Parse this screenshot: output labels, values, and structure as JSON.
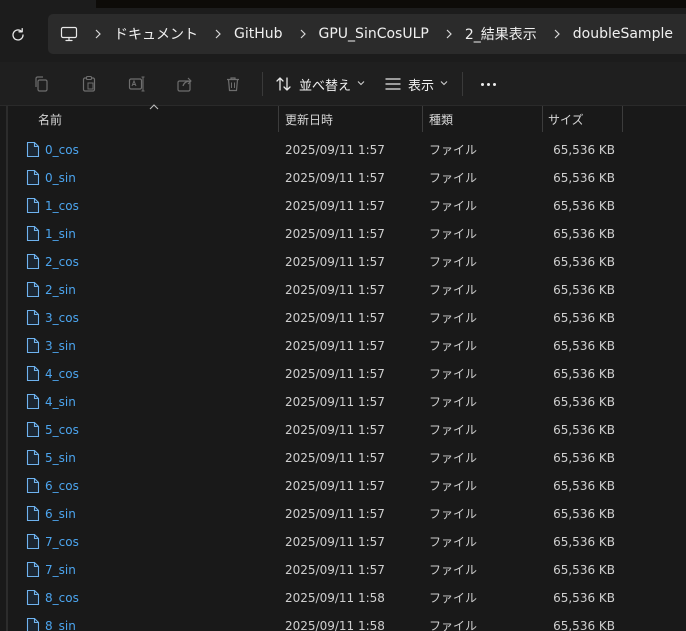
{
  "breadcrumb": {
    "items": [
      "ドキュメント",
      "GitHub",
      "GPU_SinCosULP",
      "2_結果表示",
      "doubleSample"
    ]
  },
  "toolbar": {
    "sort_label": "並べ替え",
    "view_label": "表示"
  },
  "columns": {
    "name": "名前",
    "modified": "更新日時",
    "type": "種類",
    "size": "サイズ"
  },
  "files": [
    {
      "name": "0_cos",
      "modified": "2025/09/11 1:57",
      "type": "ファイル",
      "size": "65,536 KB"
    },
    {
      "name": "0_sin",
      "modified": "2025/09/11 1:57",
      "type": "ファイル",
      "size": "65,536 KB"
    },
    {
      "name": "1_cos",
      "modified": "2025/09/11 1:57",
      "type": "ファイル",
      "size": "65,536 KB"
    },
    {
      "name": "1_sin",
      "modified": "2025/09/11 1:57",
      "type": "ファイル",
      "size": "65,536 KB"
    },
    {
      "name": "2_cos",
      "modified": "2025/09/11 1:57",
      "type": "ファイル",
      "size": "65,536 KB"
    },
    {
      "name": "2_sin",
      "modified": "2025/09/11 1:57",
      "type": "ファイル",
      "size": "65,536 KB"
    },
    {
      "name": "3_cos",
      "modified": "2025/09/11 1:57",
      "type": "ファイル",
      "size": "65,536 KB"
    },
    {
      "name": "3_sin",
      "modified": "2025/09/11 1:57",
      "type": "ファイル",
      "size": "65,536 KB"
    },
    {
      "name": "4_cos",
      "modified": "2025/09/11 1:57",
      "type": "ファイル",
      "size": "65,536 KB"
    },
    {
      "name": "4_sin",
      "modified": "2025/09/11 1:57",
      "type": "ファイル",
      "size": "65,536 KB"
    },
    {
      "name": "5_cos",
      "modified": "2025/09/11 1:57",
      "type": "ファイル",
      "size": "65,536 KB"
    },
    {
      "name": "5_sin",
      "modified": "2025/09/11 1:57",
      "type": "ファイル",
      "size": "65,536 KB"
    },
    {
      "name": "6_cos",
      "modified": "2025/09/11 1:57",
      "type": "ファイル",
      "size": "65,536 KB"
    },
    {
      "name": "6_sin",
      "modified": "2025/09/11 1:57",
      "type": "ファイル",
      "size": "65,536 KB"
    },
    {
      "name": "7_cos",
      "modified": "2025/09/11 1:57",
      "type": "ファイル",
      "size": "65,536 KB"
    },
    {
      "name": "7_sin",
      "modified": "2025/09/11 1:57",
      "type": "ファイル",
      "size": "65,536 KB"
    },
    {
      "name": "8_cos",
      "modified": "2025/09/11 1:58",
      "type": "ファイル",
      "size": "65,536 KB"
    },
    {
      "name": "8_sin",
      "modified": "2025/09/11 1:58",
      "type": "ファイル",
      "size": "65,536 KB"
    }
  ],
  "colors": {
    "link": "#4ca5ef",
    "background": "#191919"
  },
  "icons": {
    "refresh": "refresh-icon",
    "pc": "pc-icon",
    "copy": "copy-icon",
    "paste": "paste-icon",
    "rename": "rename-icon",
    "share": "share-icon",
    "delete": "trash-icon",
    "sort": "sort-icon",
    "view": "view-icon",
    "more": "more-icon",
    "file": "file-icon"
  }
}
